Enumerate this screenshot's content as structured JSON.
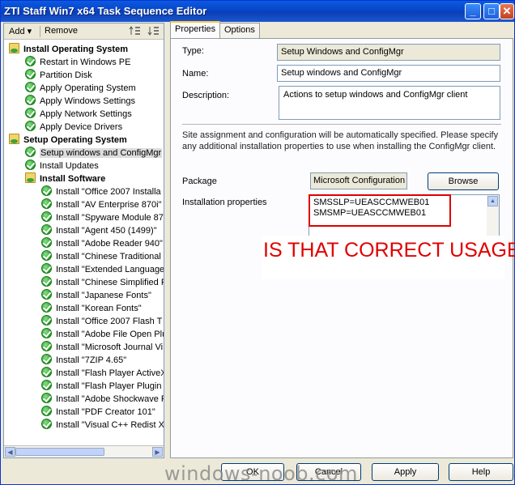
{
  "window": {
    "title": "ZTI Staff Win7 x64 Task Sequence Editor",
    "minimize": "_",
    "maximize": "□",
    "close": "✕"
  },
  "toolbar": {
    "add": "Add",
    "add_arrow": "▾",
    "remove": "Remove"
  },
  "tree": [
    {
      "label": "Install Operating System",
      "kind": "folder",
      "bold": true
    },
    {
      "label": "Restart in Windows PE",
      "kind": "ok"
    },
    {
      "label": "Partition Disk",
      "kind": "ok"
    },
    {
      "label": "Apply Operating System",
      "kind": "ok"
    },
    {
      "label": "Apply Windows Settings",
      "kind": "ok"
    },
    {
      "label": "Apply Network Settings",
      "kind": "ok"
    },
    {
      "label": "Apply Device Drivers",
      "kind": "ok"
    },
    {
      "label": "Setup Operating System",
      "kind": "folder",
      "bold": true
    },
    {
      "label": "Setup windows and ConfigMgr",
      "kind": "ok",
      "selected": true
    },
    {
      "label": "Install Updates",
      "kind": "ok"
    },
    {
      "label": "Install Software",
      "kind": "folder",
      "bold": true
    },
    {
      "label": "Install \"Office 2007 Installa",
      "kind": "ok"
    },
    {
      "label": "Install \"AV Enterprise 870i\"",
      "kind": "ok"
    },
    {
      "label": "Install \"Spyware Module 87",
      "kind": "ok"
    },
    {
      "label": "Install \"Agent 450 (1499)\"",
      "kind": "ok"
    },
    {
      "label": "Install \"Adobe Reader 940\"",
      "kind": "ok"
    },
    {
      "label": "Install \"Chinese Traditional",
      "kind": "ok"
    },
    {
      "label": "Install \"Extended Language",
      "kind": "ok"
    },
    {
      "label": "Install \"Chinese Simplified F",
      "kind": "ok"
    },
    {
      "label": "Install \"Japanese Fonts\"",
      "kind": "ok"
    },
    {
      "label": "Install \"Korean Fonts\"",
      "kind": "ok"
    },
    {
      "label": "Install \"Office 2007 Flash T",
      "kind": "ok"
    },
    {
      "label": "Install \"Adobe File Open Plu",
      "kind": "ok"
    },
    {
      "label": "Install \"Microsoft Journal Vi",
      "kind": "ok"
    },
    {
      "label": "Install \"7ZIP 4.65\"",
      "kind": "ok"
    },
    {
      "label": "Install \"Flash Player ActiveX",
      "kind": "ok"
    },
    {
      "label": "Install \"Flash Player Plugin i",
      "kind": "ok"
    },
    {
      "label": "Install \"Adobe Shockwave F",
      "kind": "ok"
    },
    {
      "label": "Install \"PDF Creator 101\"",
      "kind": "ok"
    },
    {
      "label": "Install \"Visual C++ Redist X",
      "kind": "ok"
    }
  ],
  "tabs": {
    "properties": "Properties",
    "options": "Options"
  },
  "form": {
    "type_label": "Type:",
    "type_value": "Setup Windows and ConfigMgr",
    "name_label": "Name:",
    "name_value": "Setup windows and ConfigMgr",
    "description_label": "Description:",
    "description_value": "Actions to setup windows and ConfigMgr client",
    "note": "Site assignment and configuration will be automatically specified. Please specify any additional installation properties to use when installing the ConfigMgr client.",
    "package_label": "Package",
    "package_value": "Microsoft Configuration",
    "browse": "Browse",
    "install_props_label": "Installation properties",
    "install_props_line1": "SMSSLP=UEASCCMWEB01",
    "install_props_line2": "SMSMP=UEASCCMWEB01"
  },
  "annotation": "IS THAT CORRECT USAGE",
  "buttons": {
    "ok": "OK",
    "cancel": "Cancel",
    "apply": "Apply",
    "help": "Help"
  },
  "watermark": "windows-noob.com"
}
